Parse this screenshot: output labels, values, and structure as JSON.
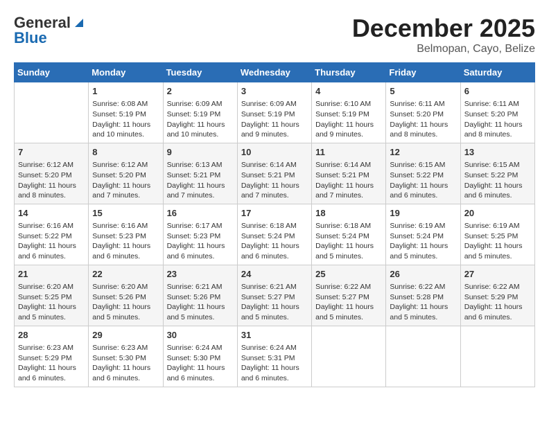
{
  "header": {
    "logo_line1": "General",
    "logo_line2": "Blue",
    "month_title": "December 2025",
    "location": "Belmopan, Cayo, Belize"
  },
  "days_of_week": [
    "Sunday",
    "Monday",
    "Tuesday",
    "Wednesday",
    "Thursday",
    "Friday",
    "Saturday"
  ],
  "weeks": [
    [
      {
        "day": "",
        "info": ""
      },
      {
        "day": "1",
        "info": "Sunrise: 6:08 AM\nSunset: 5:19 PM\nDaylight: 11 hours and 10 minutes."
      },
      {
        "day": "2",
        "info": "Sunrise: 6:09 AM\nSunset: 5:19 PM\nDaylight: 11 hours and 10 minutes."
      },
      {
        "day": "3",
        "info": "Sunrise: 6:09 AM\nSunset: 5:19 PM\nDaylight: 11 hours and 9 minutes."
      },
      {
        "day": "4",
        "info": "Sunrise: 6:10 AM\nSunset: 5:19 PM\nDaylight: 11 hours and 9 minutes."
      },
      {
        "day": "5",
        "info": "Sunrise: 6:11 AM\nSunset: 5:20 PM\nDaylight: 11 hours and 8 minutes."
      },
      {
        "day": "6",
        "info": "Sunrise: 6:11 AM\nSunset: 5:20 PM\nDaylight: 11 hours and 8 minutes."
      }
    ],
    [
      {
        "day": "7",
        "info": "Sunrise: 6:12 AM\nSunset: 5:20 PM\nDaylight: 11 hours and 8 minutes."
      },
      {
        "day": "8",
        "info": "Sunrise: 6:12 AM\nSunset: 5:20 PM\nDaylight: 11 hours and 7 minutes."
      },
      {
        "day": "9",
        "info": "Sunrise: 6:13 AM\nSunset: 5:21 PM\nDaylight: 11 hours and 7 minutes."
      },
      {
        "day": "10",
        "info": "Sunrise: 6:14 AM\nSunset: 5:21 PM\nDaylight: 11 hours and 7 minutes."
      },
      {
        "day": "11",
        "info": "Sunrise: 6:14 AM\nSunset: 5:21 PM\nDaylight: 11 hours and 7 minutes."
      },
      {
        "day": "12",
        "info": "Sunrise: 6:15 AM\nSunset: 5:22 PM\nDaylight: 11 hours and 6 minutes."
      },
      {
        "day": "13",
        "info": "Sunrise: 6:15 AM\nSunset: 5:22 PM\nDaylight: 11 hours and 6 minutes."
      }
    ],
    [
      {
        "day": "14",
        "info": "Sunrise: 6:16 AM\nSunset: 5:22 PM\nDaylight: 11 hours and 6 minutes."
      },
      {
        "day": "15",
        "info": "Sunrise: 6:16 AM\nSunset: 5:23 PM\nDaylight: 11 hours and 6 minutes."
      },
      {
        "day": "16",
        "info": "Sunrise: 6:17 AM\nSunset: 5:23 PM\nDaylight: 11 hours and 6 minutes."
      },
      {
        "day": "17",
        "info": "Sunrise: 6:18 AM\nSunset: 5:24 PM\nDaylight: 11 hours and 6 minutes."
      },
      {
        "day": "18",
        "info": "Sunrise: 6:18 AM\nSunset: 5:24 PM\nDaylight: 11 hours and 5 minutes."
      },
      {
        "day": "19",
        "info": "Sunrise: 6:19 AM\nSunset: 5:24 PM\nDaylight: 11 hours and 5 minutes."
      },
      {
        "day": "20",
        "info": "Sunrise: 6:19 AM\nSunset: 5:25 PM\nDaylight: 11 hours and 5 minutes."
      }
    ],
    [
      {
        "day": "21",
        "info": "Sunrise: 6:20 AM\nSunset: 5:25 PM\nDaylight: 11 hours and 5 minutes."
      },
      {
        "day": "22",
        "info": "Sunrise: 6:20 AM\nSunset: 5:26 PM\nDaylight: 11 hours and 5 minutes."
      },
      {
        "day": "23",
        "info": "Sunrise: 6:21 AM\nSunset: 5:26 PM\nDaylight: 11 hours and 5 minutes."
      },
      {
        "day": "24",
        "info": "Sunrise: 6:21 AM\nSunset: 5:27 PM\nDaylight: 11 hours and 5 minutes."
      },
      {
        "day": "25",
        "info": "Sunrise: 6:22 AM\nSunset: 5:27 PM\nDaylight: 11 hours and 5 minutes."
      },
      {
        "day": "26",
        "info": "Sunrise: 6:22 AM\nSunset: 5:28 PM\nDaylight: 11 hours and 5 minutes."
      },
      {
        "day": "27",
        "info": "Sunrise: 6:22 AM\nSunset: 5:29 PM\nDaylight: 11 hours and 6 minutes."
      }
    ],
    [
      {
        "day": "28",
        "info": "Sunrise: 6:23 AM\nSunset: 5:29 PM\nDaylight: 11 hours and 6 minutes."
      },
      {
        "day": "29",
        "info": "Sunrise: 6:23 AM\nSunset: 5:30 PM\nDaylight: 11 hours and 6 minutes."
      },
      {
        "day": "30",
        "info": "Sunrise: 6:24 AM\nSunset: 5:30 PM\nDaylight: 11 hours and 6 minutes."
      },
      {
        "day": "31",
        "info": "Sunrise: 6:24 AM\nSunset: 5:31 PM\nDaylight: 11 hours and 6 minutes."
      },
      {
        "day": "",
        "info": ""
      },
      {
        "day": "",
        "info": ""
      },
      {
        "day": "",
        "info": ""
      }
    ]
  ]
}
